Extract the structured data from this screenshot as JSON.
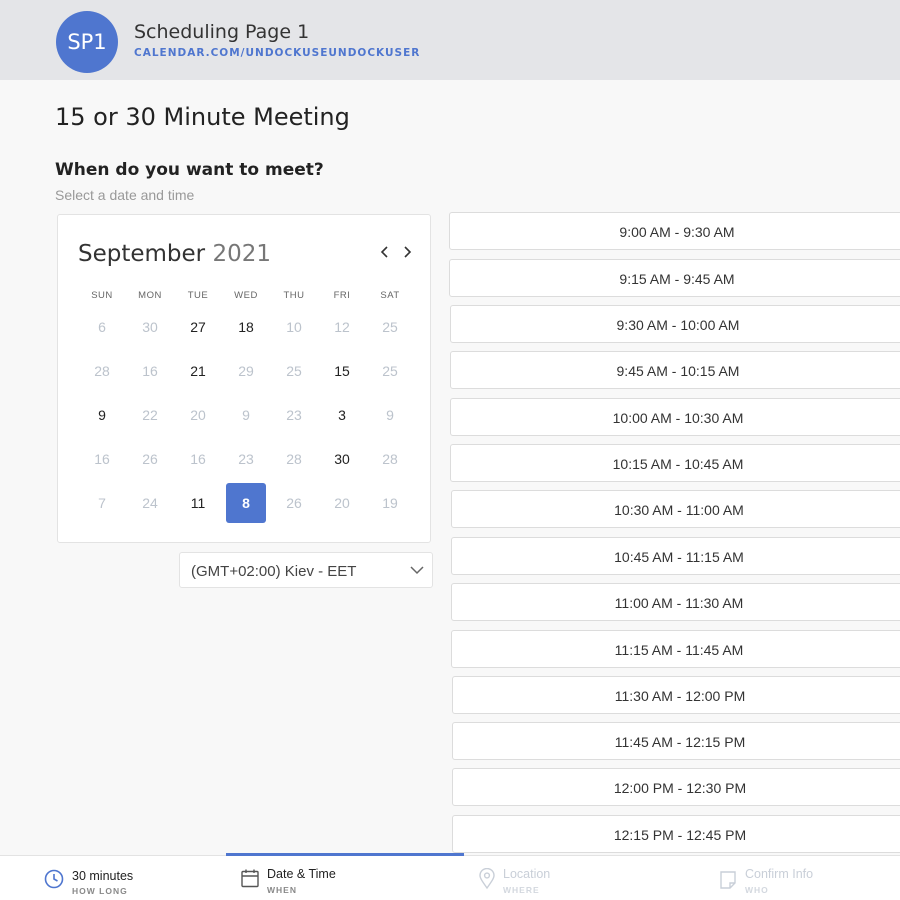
{
  "header": {
    "avatar_initials": "SP1",
    "page_name": "Scheduling Page 1",
    "page_url": "CALENDAR.COM/UNDOCKUSEUNDOCKUSER"
  },
  "main": {
    "meeting_title": "15 or 30 Minute Meeting",
    "question": "When do you want to meet?",
    "subtitle": "Select a date and time"
  },
  "calendar": {
    "month": "September",
    "year": "2021",
    "weekdays": [
      "SUN",
      "MON",
      "TUE",
      "WED",
      "THU",
      "FRI",
      "SAT"
    ],
    "weeks": [
      [
        {
          "d": "6",
          "a": false
        },
        {
          "d": "30",
          "a": false
        },
        {
          "d": "27",
          "a": true
        },
        {
          "d": "18",
          "a": true
        },
        {
          "d": "10",
          "a": false
        },
        {
          "d": "12",
          "a": false
        },
        {
          "d": "25",
          "a": false
        }
      ],
      [
        {
          "d": "28",
          "a": false
        },
        {
          "d": "16",
          "a": false
        },
        {
          "d": "21",
          "a": true
        },
        {
          "d": "29",
          "a": false
        },
        {
          "d": "25",
          "a": false
        },
        {
          "d": "15",
          "a": true
        },
        {
          "d": "25",
          "a": false
        }
      ],
      [
        {
          "d": "9",
          "a": true
        },
        {
          "d": "22",
          "a": false
        },
        {
          "d": "20",
          "a": false
        },
        {
          "d": "9",
          "a": false
        },
        {
          "d": "23",
          "a": false
        },
        {
          "d": "3",
          "a": true
        },
        {
          "d": "9",
          "a": false
        }
      ],
      [
        {
          "d": "16",
          "a": false
        },
        {
          "d": "26",
          "a": false
        },
        {
          "d": "16",
          "a": false
        },
        {
          "d": "23",
          "a": false
        },
        {
          "d": "28",
          "a": false
        },
        {
          "d": "30",
          "a": true
        },
        {
          "d": "28",
          "a": false
        }
      ],
      [
        {
          "d": "7",
          "a": false
        },
        {
          "d": "24",
          "a": false
        },
        {
          "d": "11",
          "a": true
        },
        {
          "d": "8",
          "a": true,
          "s": true
        },
        {
          "d": "26",
          "a": false
        },
        {
          "d": "20",
          "a": false
        },
        {
          "d": "19",
          "a": false
        }
      ]
    ]
  },
  "timezone": {
    "label": "(GMT+02:00) Kiev - EET"
  },
  "time_slots": [
    "9:00 AM - 9:30 AM",
    "9:15 AM - 9:45 AM",
    "9:30 AM - 10:00 AM",
    "9:45 AM - 10:15 AM",
    "10:00 AM - 10:30 AM",
    "10:15 AM - 10:45 AM",
    "10:30 AM - 11:00 AM",
    "10:45 AM - 11:15 AM",
    "11:00 AM - 11:30 AM",
    "11:15 AM - 11:45 AM",
    "11:30 AM - 12:00 PM",
    "11:45 AM - 12:15 PM",
    "12:00 PM - 12:30 PM",
    "12:15 PM - 12:45 PM"
  ],
  "steps": [
    {
      "label": "30 minutes",
      "sub": "HOW LONG",
      "icon": "clock-icon",
      "state": "done"
    },
    {
      "label": "Date & Time",
      "sub": "WHEN",
      "icon": "calendar-icon",
      "state": "active"
    },
    {
      "label": "Location",
      "sub": "WHERE",
      "icon": "location-pin-icon",
      "state": "disabled"
    },
    {
      "label": "Confirm Info",
      "sub": "WHO",
      "icon": "note-icon",
      "state": "disabled"
    }
  ],
  "colors": {
    "accent": "#4f76cf",
    "header_bg": "#e4e5e8",
    "muted_day": "#bcc3cc"
  }
}
